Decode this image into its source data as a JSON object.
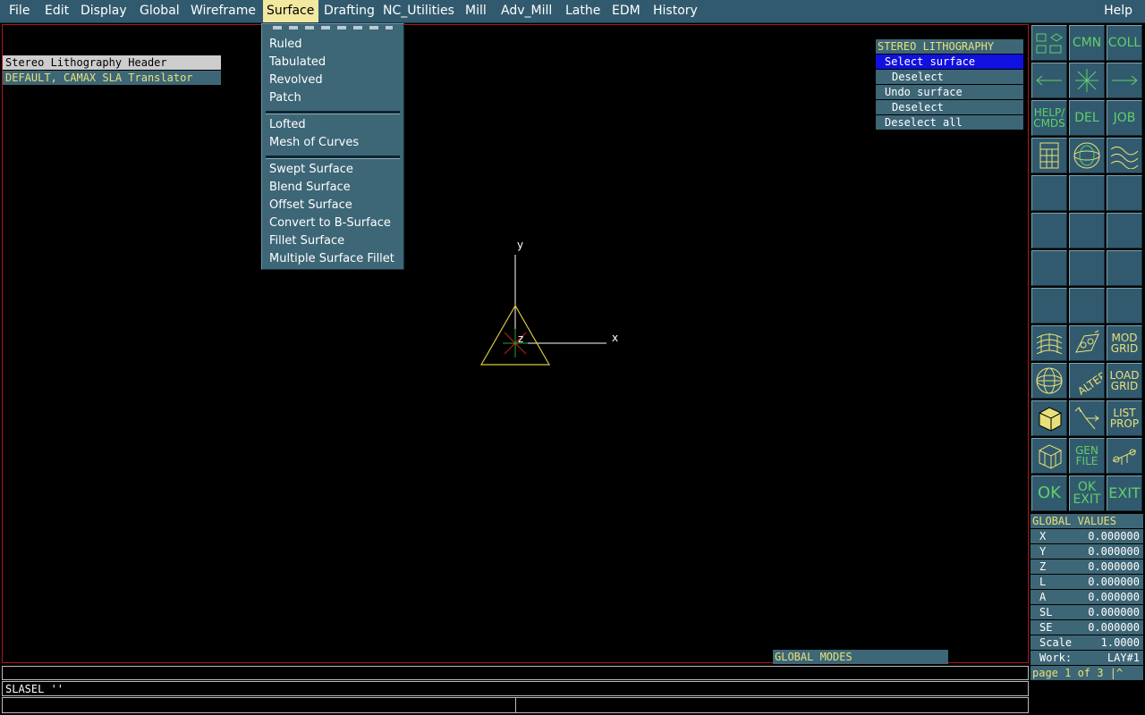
{
  "menubar": {
    "items": [
      "File",
      "Edit",
      "Display",
      "Global",
      "Wireframe",
      "Surface",
      "Drafting",
      "NC_Utilities",
      "Mill",
      "Adv_Mill",
      "Lathe",
      "EDM",
      "History"
    ],
    "active": "Surface",
    "help": "Help"
  },
  "surface_menu": {
    "group1": [
      "Ruled",
      "Tabulated",
      "Revolved",
      "Patch"
    ],
    "group2": [
      "Lofted",
      "Mesh of Curves"
    ],
    "group3": [
      "Swept Surface",
      "Blend Surface",
      "Offset Surface",
      "Convert to B-Surface",
      "Fillet Surface",
      "Multiple Surface Fillet"
    ]
  },
  "header_box": {
    "label": "Stereo Lithography Header",
    "value": "DEFAULT, CAMAX SLA Translator"
  },
  "sla_menu": {
    "title": "STEREO LITHOGRAPHY",
    "items": [
      "Select surface",
      "Deselect",
      "Undo surface",
      "Deselect",
      "Deselect all"
    ]
  },
  "axes": {
    "y": "y",
    "x": "x",
    "z": "z"
  },
  "buttons": {
    "cmn": "CMN",
    "coll": "COLL",
    "help1": "HELP/",
    "help2": "CMDS",
    "del": "DEL",
    "job": "JOB",
    "mod1": "MOD",
    "mod2": "GRID",
    "load1": "LOAD",
    "load2": "GRID",
    "list1": "LIST",
    "list2": "PROP",
    "gen1": "GEN",
    "gen2": "FILE",
    "ok": "OK",
    "okexit1": "OK",
    "okexit2": "EXIT",
    "exit": "EXIT",
    "alter": "ALTER"
  },
  "global_values": {
    "title": "GLOBAL VALUES",
    "rows": [
      {
        "k": "X",
        "v": "0.000000"
      },
      {
        "k": "Y",
        "v": "0.000000"
      },
      {
        "k": "Z",
        "v": "0.000000"
      },
      {
        "k": "L",
        "v": "0.000000"
      },
      {
        "k": "A",
        "v": "0.000000"
      },
      {
        "k": "SL",
        "v": "0.000000"
      },
      {
        "k": "SE",
        "v": "0.000000"
      }
    ],
    "scale_label": "Scale",
    "scale_value": "1.0000",
    "work_label": "Work:",
    "work_value": "LAY#1",
    "page": "page 1 of 3 |^"
  },
  "global_modes": "GLOBAL MODES",
  "command": "SLASEL ''",
  "colors": {
    "panel": "#3d6676",
    "yellow": "#e8e07a",
    "green": "#5fd06a",
    "select": "#1010e0",
    "border": "#b01818"
  }
}
